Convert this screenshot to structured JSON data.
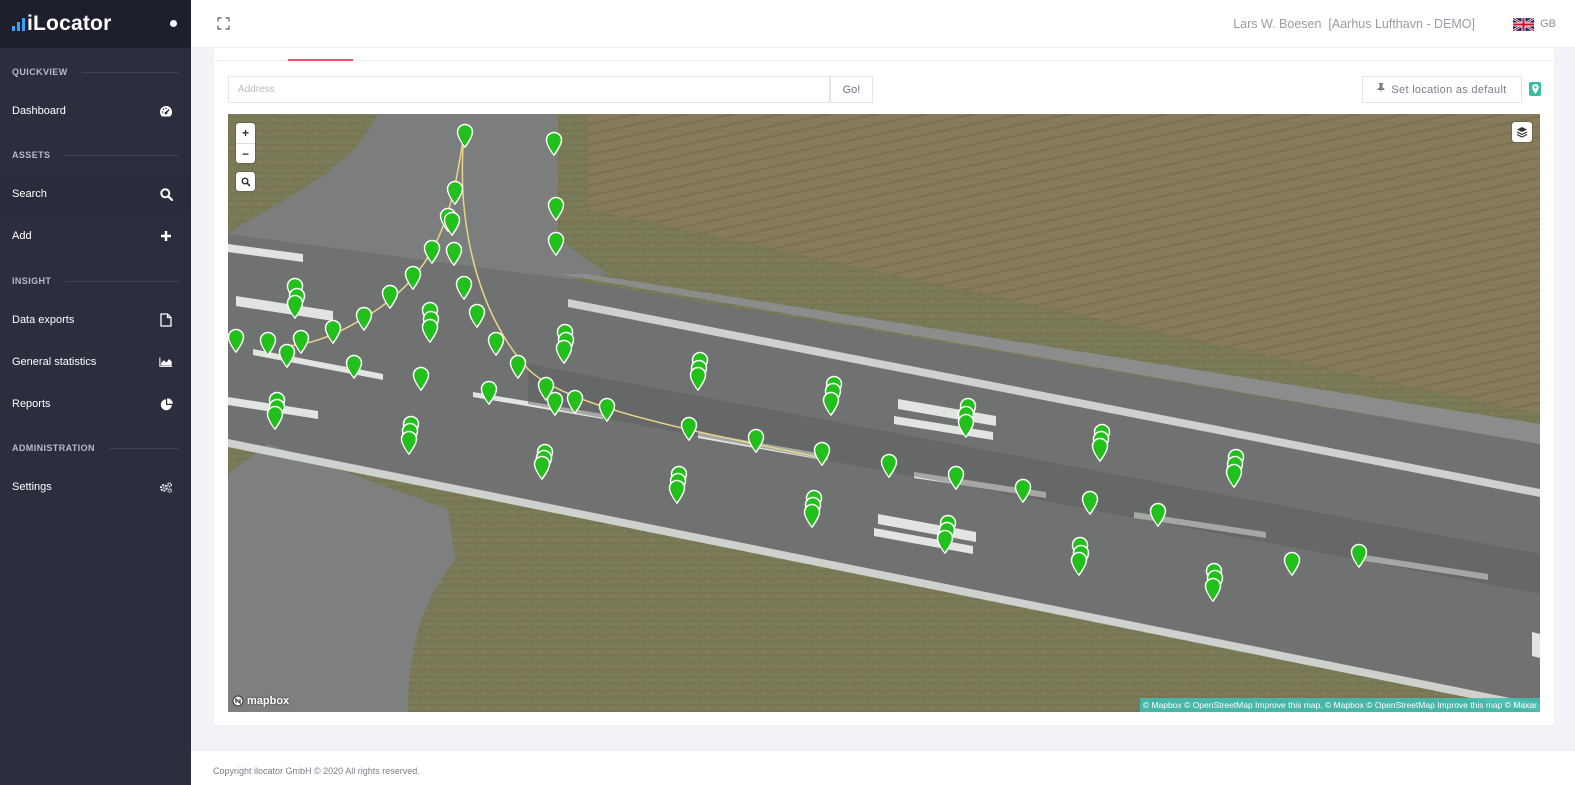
{
  "app": {
    "brand": "iLocator"
  },
  "sidebar": {
    "sections": [
      {
        "label": "QUICKVIEW"
      },
      {
        "label": "ASSETS"
      },
      {
        "label": "INSIGHT"
      },
      {
        "label": "ADMINISTRATION"
      }
    ],
    "items": [
      {
        "label": "Dashboard",
        "icon": "dashboard-gauge-icon"
      },
      {
        "label": "Search",
        "icon": "search-icon"
      },
      {
        "label": "Add",
        "icon": "plus-icon"
      },
      {
        "label": "Data exports",
        "icon": "file-icon"
      },
      {
        "label": "General statistics",
        "icon": "area-chart-icon"
      },
      {
        "label": "Reports",
        "icon": "pie-chart-icon"
      },
      {
        "label": "Settings",
        "icon": "gears-icon"
      }
    ]
  },
  "header": {
    "user": "Lars W. Boesen",
    "organization": "[Aarhus Lufthavn - DEMO]",
    "language": "GB",
    "flag_icon": "uk-flag-icon"
  },
  "toolbar": {
    "address_placeholder": "Address",
    "address_value": "",
    "go_label": "Go!",
    "default_label": "Set location as default",
    "pin_icon": "thumbtack-icon",
    "location_icon": "map-marker-icon"
  },
  "map": {
    "zoom_in": "+",
    "zoom_out": "−",
    "logo": "mapbox",
    "attribution": "© Mapbox © OpenStreetMap Improve this map, © Mapbox © OpenStreetMap Improve this map © Maxar",
    "marker_color": "#22c01a",
    "marker_count": 86
  },
  "footer": {
    "copyright": "Copyright ilocator GmbH © 2020 All rights reserved."
  },
  "colors": {
    "accent": "#f4516c",
    "sidebar": "#2c2e3e",
    "brand_bg": "#1e1f2d",
    "teal": "#34bfa3"
  }
}
